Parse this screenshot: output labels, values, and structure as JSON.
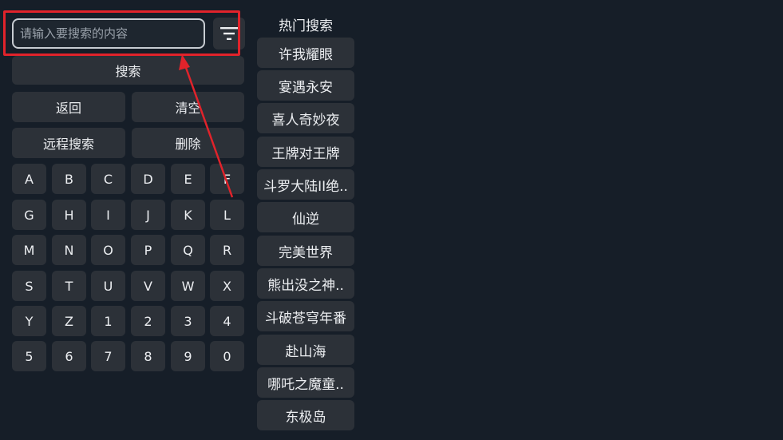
{
  "search": {
    "placeholder": "请输入要搜索的内容",
    "value": "",
    "filter_icon": "filter-icon",
    "search_label": "搜索"
  },
  "actions": {
    "back": "返回",
    "clear": "清空",
    "remote_search": "远程搜索",
    "delete": "删除"
  },
  "keyboard": {
    "rows": [
      [
        "A",
        "B",
        "C",
        "D",
        "E",
        "F"
      ],
      [
        "G",
        "H",
        "I",
        "J",
        "K",
        "L"
      ],
      [
        "M",
        "N",
        "O",
        "P",
        "Q",
        "R"
      ],
      [
        "S",
        "T",
        "U",
        "V",
        "W",
        "X"
      ],
      [
        "Y",
        "Z",
        "1",
        "2",
        "3",
        "4"
      ],
      [
        "5",
        "6",
        "7",
        "8",
        "9",
        "0"
      ]
    ]
  },
  "hot": {
    "title": "热门搜索",
    "items": [
      "许我耀眼",
      "宴遇永安",
      "喜人奇妙夜",
      "王牌对王牌",
      "斗罗大陆II绝..",
      "仙逆",
      "完美世界",
      "熊出没之神..",
      "斗破苍穹年番",
      "赴山海",
      "哪吒之魔童..",
      "东极岛"
    ]
  },
  "colors": {
    "background": "#161e28",
    "button": "#2c3138",
    "annotation": "#e1232b"
  }
}
